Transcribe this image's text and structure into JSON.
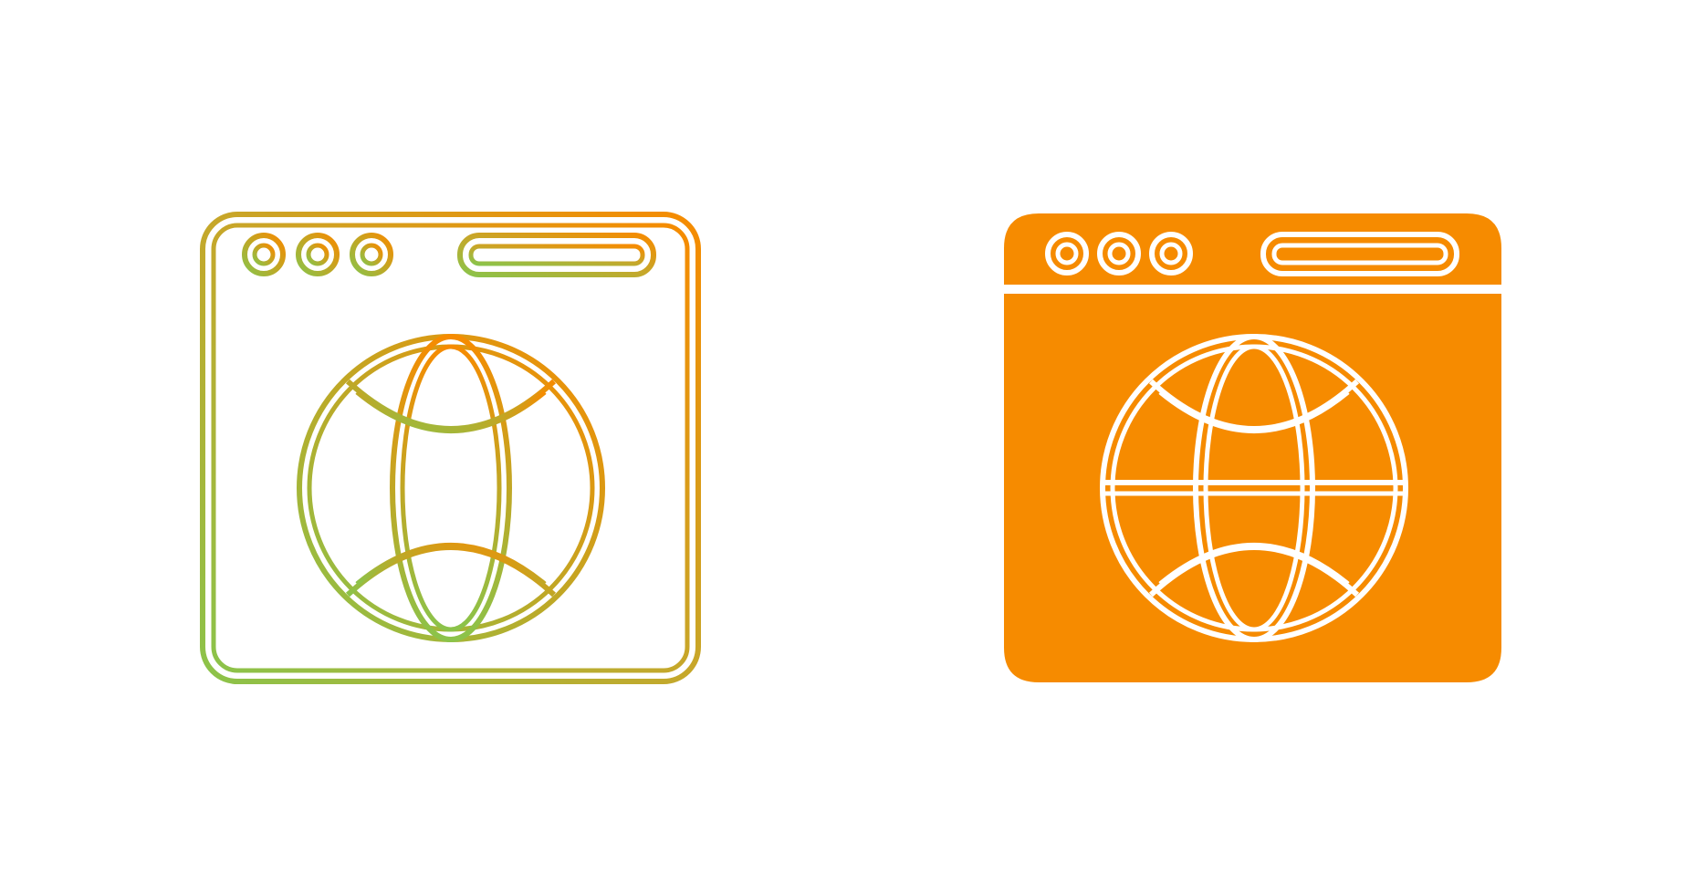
{
  "icons": [
    {
      "name": "browser-globe-icon",
      "style": "outline-gradient",
      "gradient_start": "#8bc34a",
      "gradient_end": "#f68b00"
    },
    {
      "name": "browser-globe-icon",
      "style": "solid",
      "fill": "#f68b00",
      "stroke": "#ffffff"
    }
  ],
  "colors": {
    "background": "#ffffff",
    "green": "#8bc34a",
    "orange": "#f68b00",
    "white": "#ffffff"
  }
}
